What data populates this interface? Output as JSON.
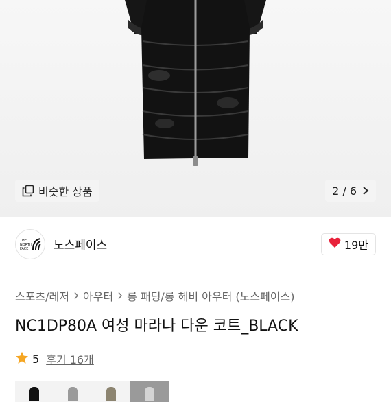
{
  "hero": {
    "similar_label": "비슷한 상품",
    "counter": "2 / 6"
  },
  "brand": {
    "logo_text": "THE NORTH FACE",
    "name": "노스페이스",
    "like_count": "19만"
  },
  "breadcrumb": [
    "스포츠/레저",
    "아우터",
    "롱 패딩/롱 헤비 아우터 (노스페이스)"
  ],
  "product": {
    "title": "NC1DP80A 여성 마라나 다운 코트_BLACK"
  },
  "rating": {
    "score": "5",
    "reviews_label": "후기 16개"
  },
  "colors": {
    "heart": "#e8223b",
    "star": "#f5a623",
    "coat": "#141414"
  }
}
